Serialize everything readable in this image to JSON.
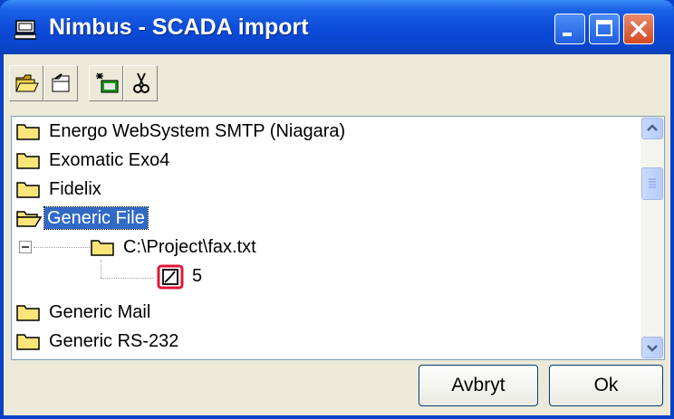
{
  "window": {
    "title": "Nimbus - SCADA import"
  },
  "toolbar": {
    "buttons": [
      {
        "icon": "open-folder-icon"
      },
      {
        "icon": "undo-folder-icon"
      },
      {
        "icon": "new-item-icon"
      },
      {
        "icon": "cut-icon"
      }
    ]
  },
  "tree": {
    "items": [
      {
        "label": "Energo WebSystem SMTP (Niagara)"
      },
      {
        "label": "Exomatic Exo4"
      },
      {
        "label": "Fidelix"
      },
      {
        "label": "Generic File",
        "selected": true,
        "expanded": true
      },
      {
        "label": "C:\\Project\\fax.txt"
      },
      {
        "label": "5"
      },
      {
        "label": "Generic Mail"
      },
      {
        "label": "Generic RS-232"
      }
    ]
  },
  "buttons": {
    "cancel": "Avbryt",
    "ok": "Ok"
  },
  "colors": {
    "titlebar": "#0a45cc",
    "selection": "#316ac5",
    "close": "#d24a22"
  }
}
